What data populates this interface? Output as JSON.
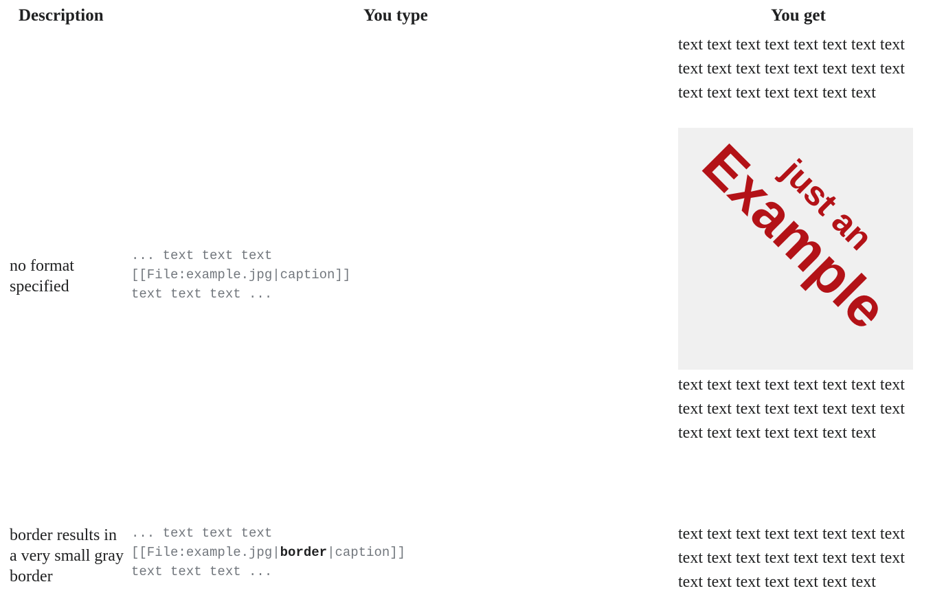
{
  "headers": {
    "description": "Description",
    "you_type": "You type",
    "you_get": "You get"
  },
  "rows": [
    {
      "description": "no format specified",
      "code": {
        "line1": "... text text text",
        "line2_pre": "[[File:example.jpg|",
        "line2_bold": "",
        "line2_post": "caption]]",
        "line3": "text text text ..."
      },
      "result_before": "text text text text text text text text text text text text text text text text text text text text text text text",
      "result_after": "text text text text text text text text text text text text text text text text text text text text text text text"
    },
    {
      "description": "border results in a very small gray border",
      "code": {
        "line1": "... text text text",
        "line2_pre": "[[File:example.jpg|",
        "line2_bold": "border",
        "line2_post": "|caption]]",
        "line3": "text text text ..."
      },
      "result_before": "text text text text text text text text text text text text text text text text text text text text text text text"
    }
  ],
  "example_image": {
    "text_small": "just an",
    "text_large": "Example",
    "text_color": "#b31217",
    "background": "#f0f0f0"
  }
}
